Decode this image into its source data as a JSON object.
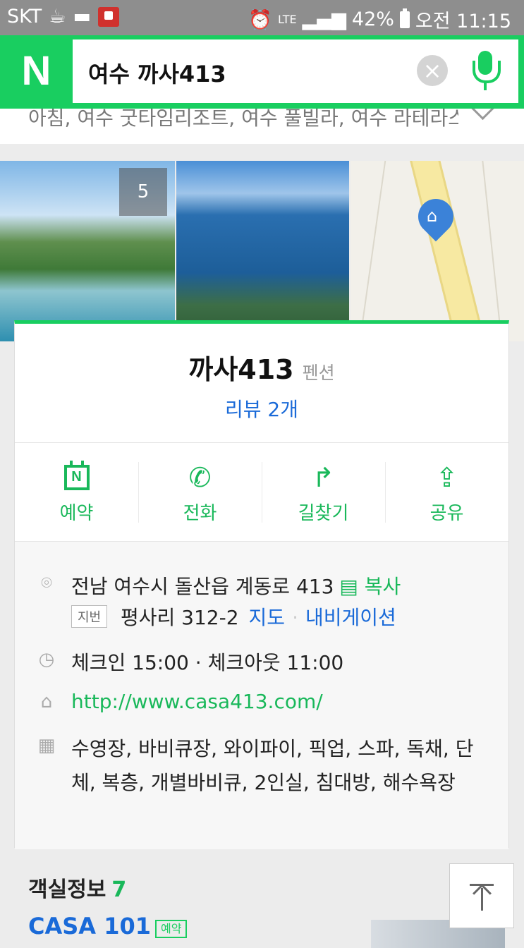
{
  "status_bar": {
    "carrier": "SKT",
    "network": "LTE",
    "battery": "42%",
    "time": "오전 11:15",
    "icons": [
      "coffee-icon",
      "chat-icon",
      "homeplus-icon",
      "alarm-icon",
      "signal-icon",
      "battery-icon"
    ]
  },
  "header": {
    "logo": "N",
    "search_query": "여수 까사413",
    "clear_icon": "×",
    "suggestions": "아침, 여수 굿타임리조트, 여수 풀빌라, 여수 라테라스"
  },
  "photos": {
    "count": "5"
  },
  "place": {
    "name": "까사413",
    "category": "펜션",
    "reviews": "리뷰 2개"
  },
  "actions": [
    {
      "label": "예약",
      "icon": "calendar-icon"
    },
    {
      "label": "전화",
      "icon": "phone-icon"
    },
    {
      "label": "길찾기",
      "icon": "directions-icon"
    },
    {
      "label": "공유",
      "icon": "share-icon"
    }
  ],
  "info": {
    "address": "전남 여수시 돌산읍 계동로 413",
    "copy": "복사",
    "lot_badge": "지번",
    "lot_address": "평사리 312-2",
    "map": "지도",
    "separator": "·",
    "navigation": "내비게이션",
    "check_time": "체크인 15:00 · 체크아웃 11:00",
    "website": "http://www.casa413.com/",
    "amenities": "수영장, 바비큐장, 와이파이, 픽업, 스파, 독채, 단체, 복층, 개별바비큐, 2인실, 침대방, 해수욕장"
  },
  "rooms": {
    "title": "객실정보",
    "count": "7",
    "first_room": "CASA 101",
    "book_badge": "예약"
  },
  "colors": {
    "brand_green": "#19ce60",
    "link_blue": "#1a6ad8"
  }
}
